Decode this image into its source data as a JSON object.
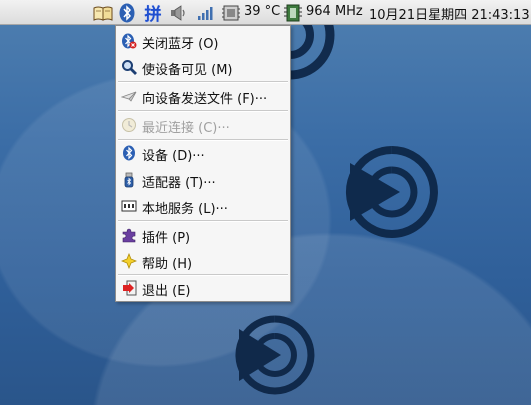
{
  "panel": {
    "temperature": "39 °C",
    "cpu_freq": "964 MHz",
    "datetime": "10月21日星期四 21:43:13",
    "ime_label": "拼"
  },
  "menu": {
    "items": [
      {
        "label": "关闭蓝牙 (O)",
        "icon": "bluetooth-off-icon",
        "enabled": true
      },
      {
        "label": "使设备可见 (M)",
        "icon": "magnifier-icon",
        "enabled": true
      },
      {
        "label": "向设备发送文件 (F)···",
        "icon": "paper-plane-icon",
        "enabled": true
      },
      {
        "label": "最近连接 (C)···",
        "icon": "clock-icon",
        "enabled": false
      },
      {
        "label": "设备 (D)···",
        "icon": "bluetooth-icon",
        "enabled": true
      },
      {
        "label": "适配器 (T)···",
        "icon": "usb-dongle-icon",
        "enabled": true
      },
      {
        "label": "本地服务 (L)···",
        "icon": "local-services-icon",
        "enabled": true
      },
      {
        "label": "插件 (P)",
        "icon": "puzzle-icon",
        "enabled": true
      },
      {
        "label": "帮助 (H)",
        "icon": "help-star-icon",
        "enabled": true
      },
      {
        "label": "退出 (E)",
        "icon": "exit-icon",
        "enabled": true
      }
    ]
  },
  "colors": {
    "desktop": "#3b6da6",
    "bluetooth": "#2b5fb3",
    "ime": "#1f4fcf",
    "menu_bg": "#f6f6f6"
  }
}
